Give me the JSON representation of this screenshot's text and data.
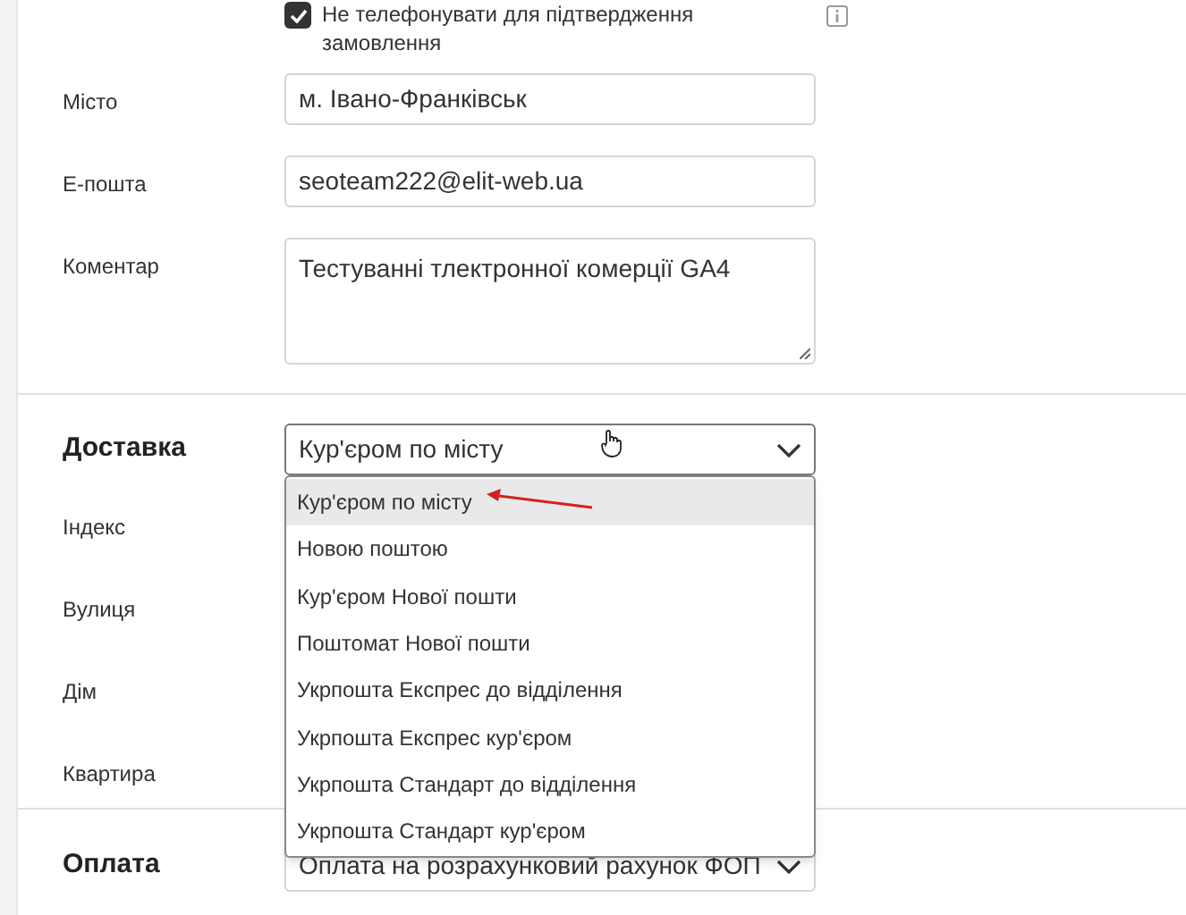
{
  "consent": {
    "label": "Не телефонувати для підтвердження замовлення",
    "checked": true
  },
  "contact_fields": [
    {
      "label": "Місто",
      "value": "м. Івано-Франківськ",
      "kind": "input"
    },
    {
      "label": "Е-пошта",
      "value": "seoteam222@elit-web.ua",
      "kind": "input"
    },
    {
      "label": "Коментар",
      "value": "Тестуванні тлектронної комерції GA4",
      "kind": "textarea"
    }
  ],
  "delivery": {
    "heading": "Доставка",
    "value": "Кур'єром по місту",
    "expanded": true,
    "options": [
      {
        "label": "Кур'єром по місту",
        "selected": true
      },
      {
        "label": "Новою поштою",
        "selected": false
      },
      {
        "label": "Кур'єром Нової пошти",
        "selected": false
      },
      {
        "label": "Поштомат Нової пошти",
        "selected": false
      },
      {
        "label": "Укрпошта Експрес до відділення",
        "selected": false
      },
      {
        "label": "Укрпошта Експрес кур'єром",
        "selected": false
      },
      {
        "label": "Укрпошта Стандарт до відділення",
        "selected": false
      },
      {
        "label": "Укрпошта Стандарт кур'єром",
        "selected": false
      }
    ],
    "fields": [
      {
        "label": "Індекс"
      },
      {
        "label": "Вулиця"
      },
      {
        "label": "Дім"
      },
      {
        "label": "Квартира"
      }
    ]
  },
  "payment": {
    "heading": "Оплата",
    "value": "Оплата на розрахунковий рахунок ФОП"
  }
}
